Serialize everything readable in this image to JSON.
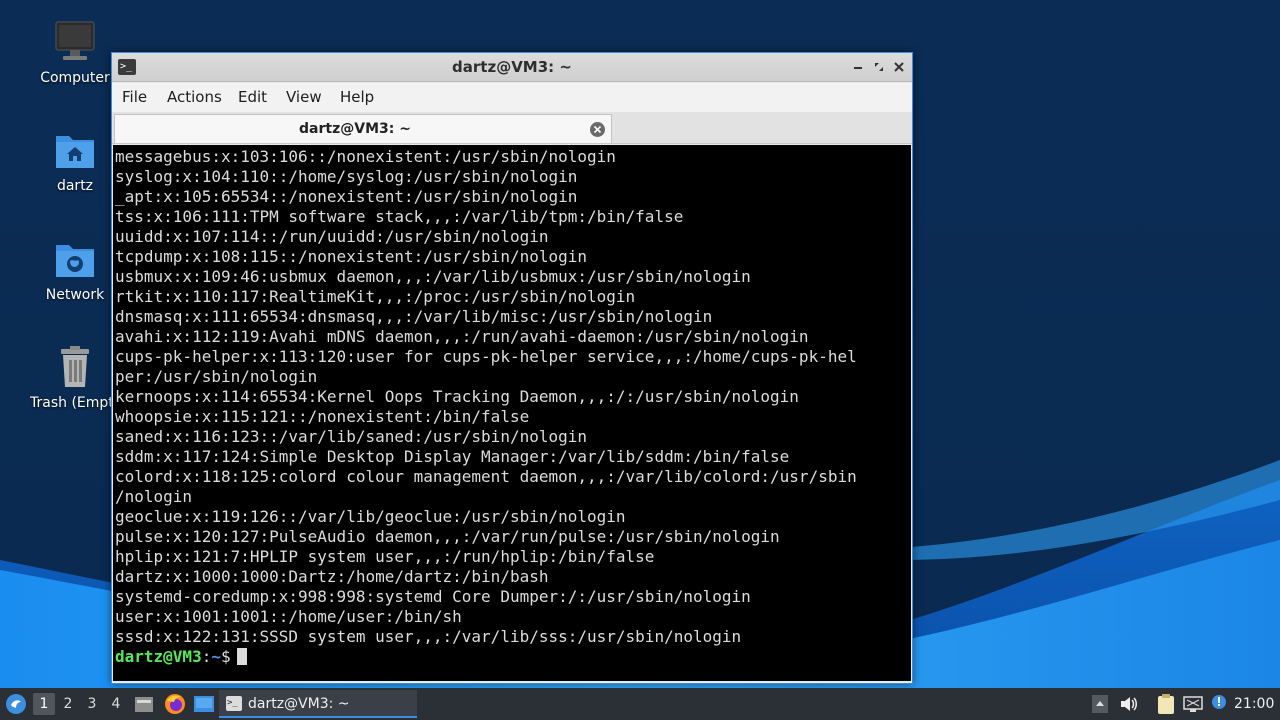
{
  "desktop": {
    "icons": [
      {
        "label": "Computer"
      },
      {
        "label": "dartz"
      },
      {
        "label": "Network"
      },
      {
        "label": "Trash (Empty)"
      }
    ]
  },
  "window": {
    "title": "dartz@VM3: ~",
    "menu": [
      "File",
      "Actions",
      "Edit",
      "View",
      "Help"
    ],
    "tab_label": "dartz@VM3: ~",
    "terminal": {
      "lines": [
        "messagebus:x:103:106::/nonexistent:/usr/sbin/nologin",
        "syslog:x:104:110::/home/syslog:/usr/sbin/nologin",
        "_apt:x:105:65534::/nonexistent:/usr/sbin/nologin",
        "tss:x:106:111:TPM software stack,,,:/var/lib/tpm:/bin/false",
        "uuidd:x:107:114::/run/uuidd:/usr/sbin/nologin",
        "tcpdump:x:108:115::/nonexistent:/usr/sbin/nologin",
        "usbmux:x:109:46:usbmux daemon,,,:/var/lib/usbmux:/usr/sbin/nologin",
        "rtkit:x:110:117:RealtimeKit,,,:/proc:/usr/sbin/nologin",
        "dnsmasq:x:111:65534:dnsmasq,,,:/var/lib/misc:/usr/sbin/nologin",
        "avahi:x:112:119:Avahi mDNS daemon,,,:/run/avahi-daemon:/usr/sbin/nologin",
        "cups-pk-helper:x:113:120:user for cups-pk-helper service,,,:/home/cups-pk-hel",
        "per:/usr/sbin/nologin",
        "kernoops:x:114:65534:Kernel Oops Tracking Daemon,,,:/:/usr/sbin/nologin",
        "whoopsie:x:115:121::/nonexistent:/bin/false",
        "saned:x:116:123::/var/lib/saned:/usr/sbin/nologin",
        "sddm:x:117:124:Simple Desktop Display Manager:/var/lib/sddm:/bin/false",
        "colord:x:118:125:colord colour management daemon,,,:/var/lib/colord:/usr/sbin",
        "/nologin",
        "geoclue:x:119:126::/var/lib/geoclue:/usr/sbin/nologin",
        "pulse:x:120:127:PulseAudio daemon,,,:/var/run/pulse:/usr/sbin/nologin",
        "hplip:x:121:7:HPLIP system user,,,:/run/hplip:/bin/false",
        "dartz:x:1000:1000:Dartz:/home/dartz:/bin/bash",
        "systemd-coredump:x:998:998:systemd Core Dumper:/:/usr/sbin/nologin",
        "user:x:1001:1001::/home/user:/bin/sh",
        "sssd:x:122:131:SSSD system user,,,:/var/lib/sss:/usr/sbin/nologin"
      ],
      "prompt_user": "dartz@VM3",
      "prompt_sep": ":",
      "prompt_path": "~",
      "prompt_symbol": "$"
    }
  },
  "taskbar": {
    "workspaces": [
      "1",
      "2",
      "3",
      "4"
    ],
    "active_workspace": "1",
    "task_label": "dartz@VM3: ~",
    "clock": "21:00"
  },
  "colors": {
    "prompt_user": "#55ea55",
    "prompt_path": "#5a8cf0",
    "accent": "#3b8ee0"
  }
}
